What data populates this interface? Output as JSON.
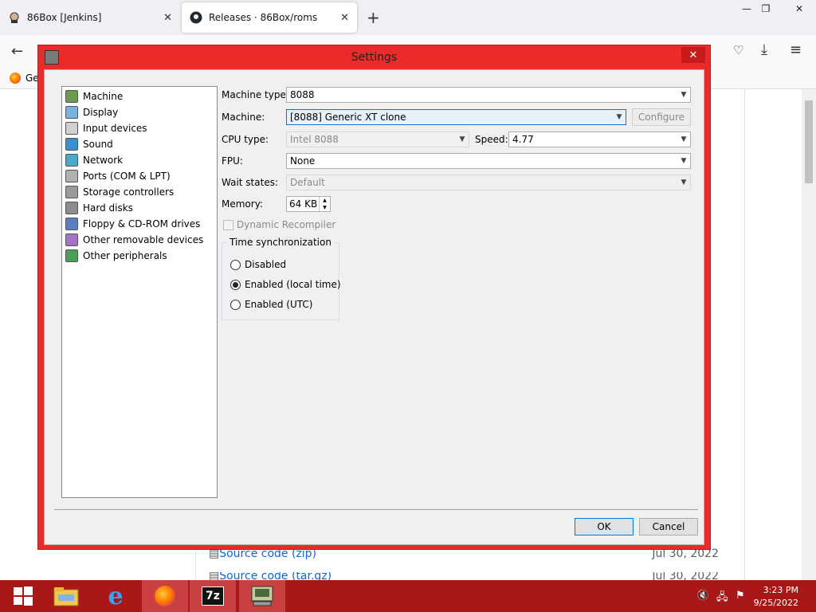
{
  "browser": {
    "tabs": [
      {
        "label": "86Box [Jenkins]",
        "icon": "jenkins-icon"
      },
      {
        "label": "Releases · 86Box/roms",
        "icon": "github-icon"
      }
    ],
    "new_tab_glyph": "+",
    "bookmark_label": "Ge",
    "assets": [
      {
        "name": "Source code",
        "ext": "(zip)",
        "date": "Jul 30, 2022"
      },
      {
        "name": "Source code",
        "ext": "(tar.gz)",
        "date": "Jul 30, 2022"
      }
    ]
  },
  "dialog": {
    "title": "Settings",
    "close_glyph": "✕",
    "categories": [
      "Machine",
      "Display",
      "Input devices",
      "Sound",
      "Network",
      "Ports (COM & LPT)",
      "Storage controllers",
      "Hard disks",
      "Floppy & CD-ROM drives",
      "Other removable devices",
      "Other peripherals"
    ],
    "machine": {
      "machine_type_label": "Machine type:",
      "machine_type_value": "8088",
      "machine_label": "Machine:",
      "machine_value": "[8088] Generic XT clone",
      "configure_label": "Configure",
      "cpu_type_label": "CPU type:",
      "cpu_type_value": "Intel 8088",
      "speed_label": "Speed:",
      "speed_value": "4.77",
      "fpu_label": "FPU:",
      "fpu_value": "None",
      "wait_states_label": "Wait states:",
      "wait_states_value": "Default",
      "memory_label": "Memory:",
      "memory_value": "64 KB",
      "dynamic_recompiler_label": "Dynamic Recompiler",
      "time_sync_label": "Time synchronization",
      "time_sync_options": [
        "Disabled",
        "Enabled (local time)",
        "Enabled (UTC)"
      ],
      "time_sync_selected": "Enabled (local time)"
    },
    "ok_label": "OK",
    "cancel_label": "Cancel"
  },
  "taskbar": {
    "time": "3:23 PM",
    "date": "9/25/2022",
    "apps": [
      "windows-start-icon",
      "file-explorer-icon",
      "internet-explorer-icon",
      "firefox-icon",
      "7zip-icon",
      "86box-icon"
    ]
  },
  "colors": {
    "accent": "#eb2a2a",
    "taskbar": "#a81818",
    "link": "#0969da"
  }
}
